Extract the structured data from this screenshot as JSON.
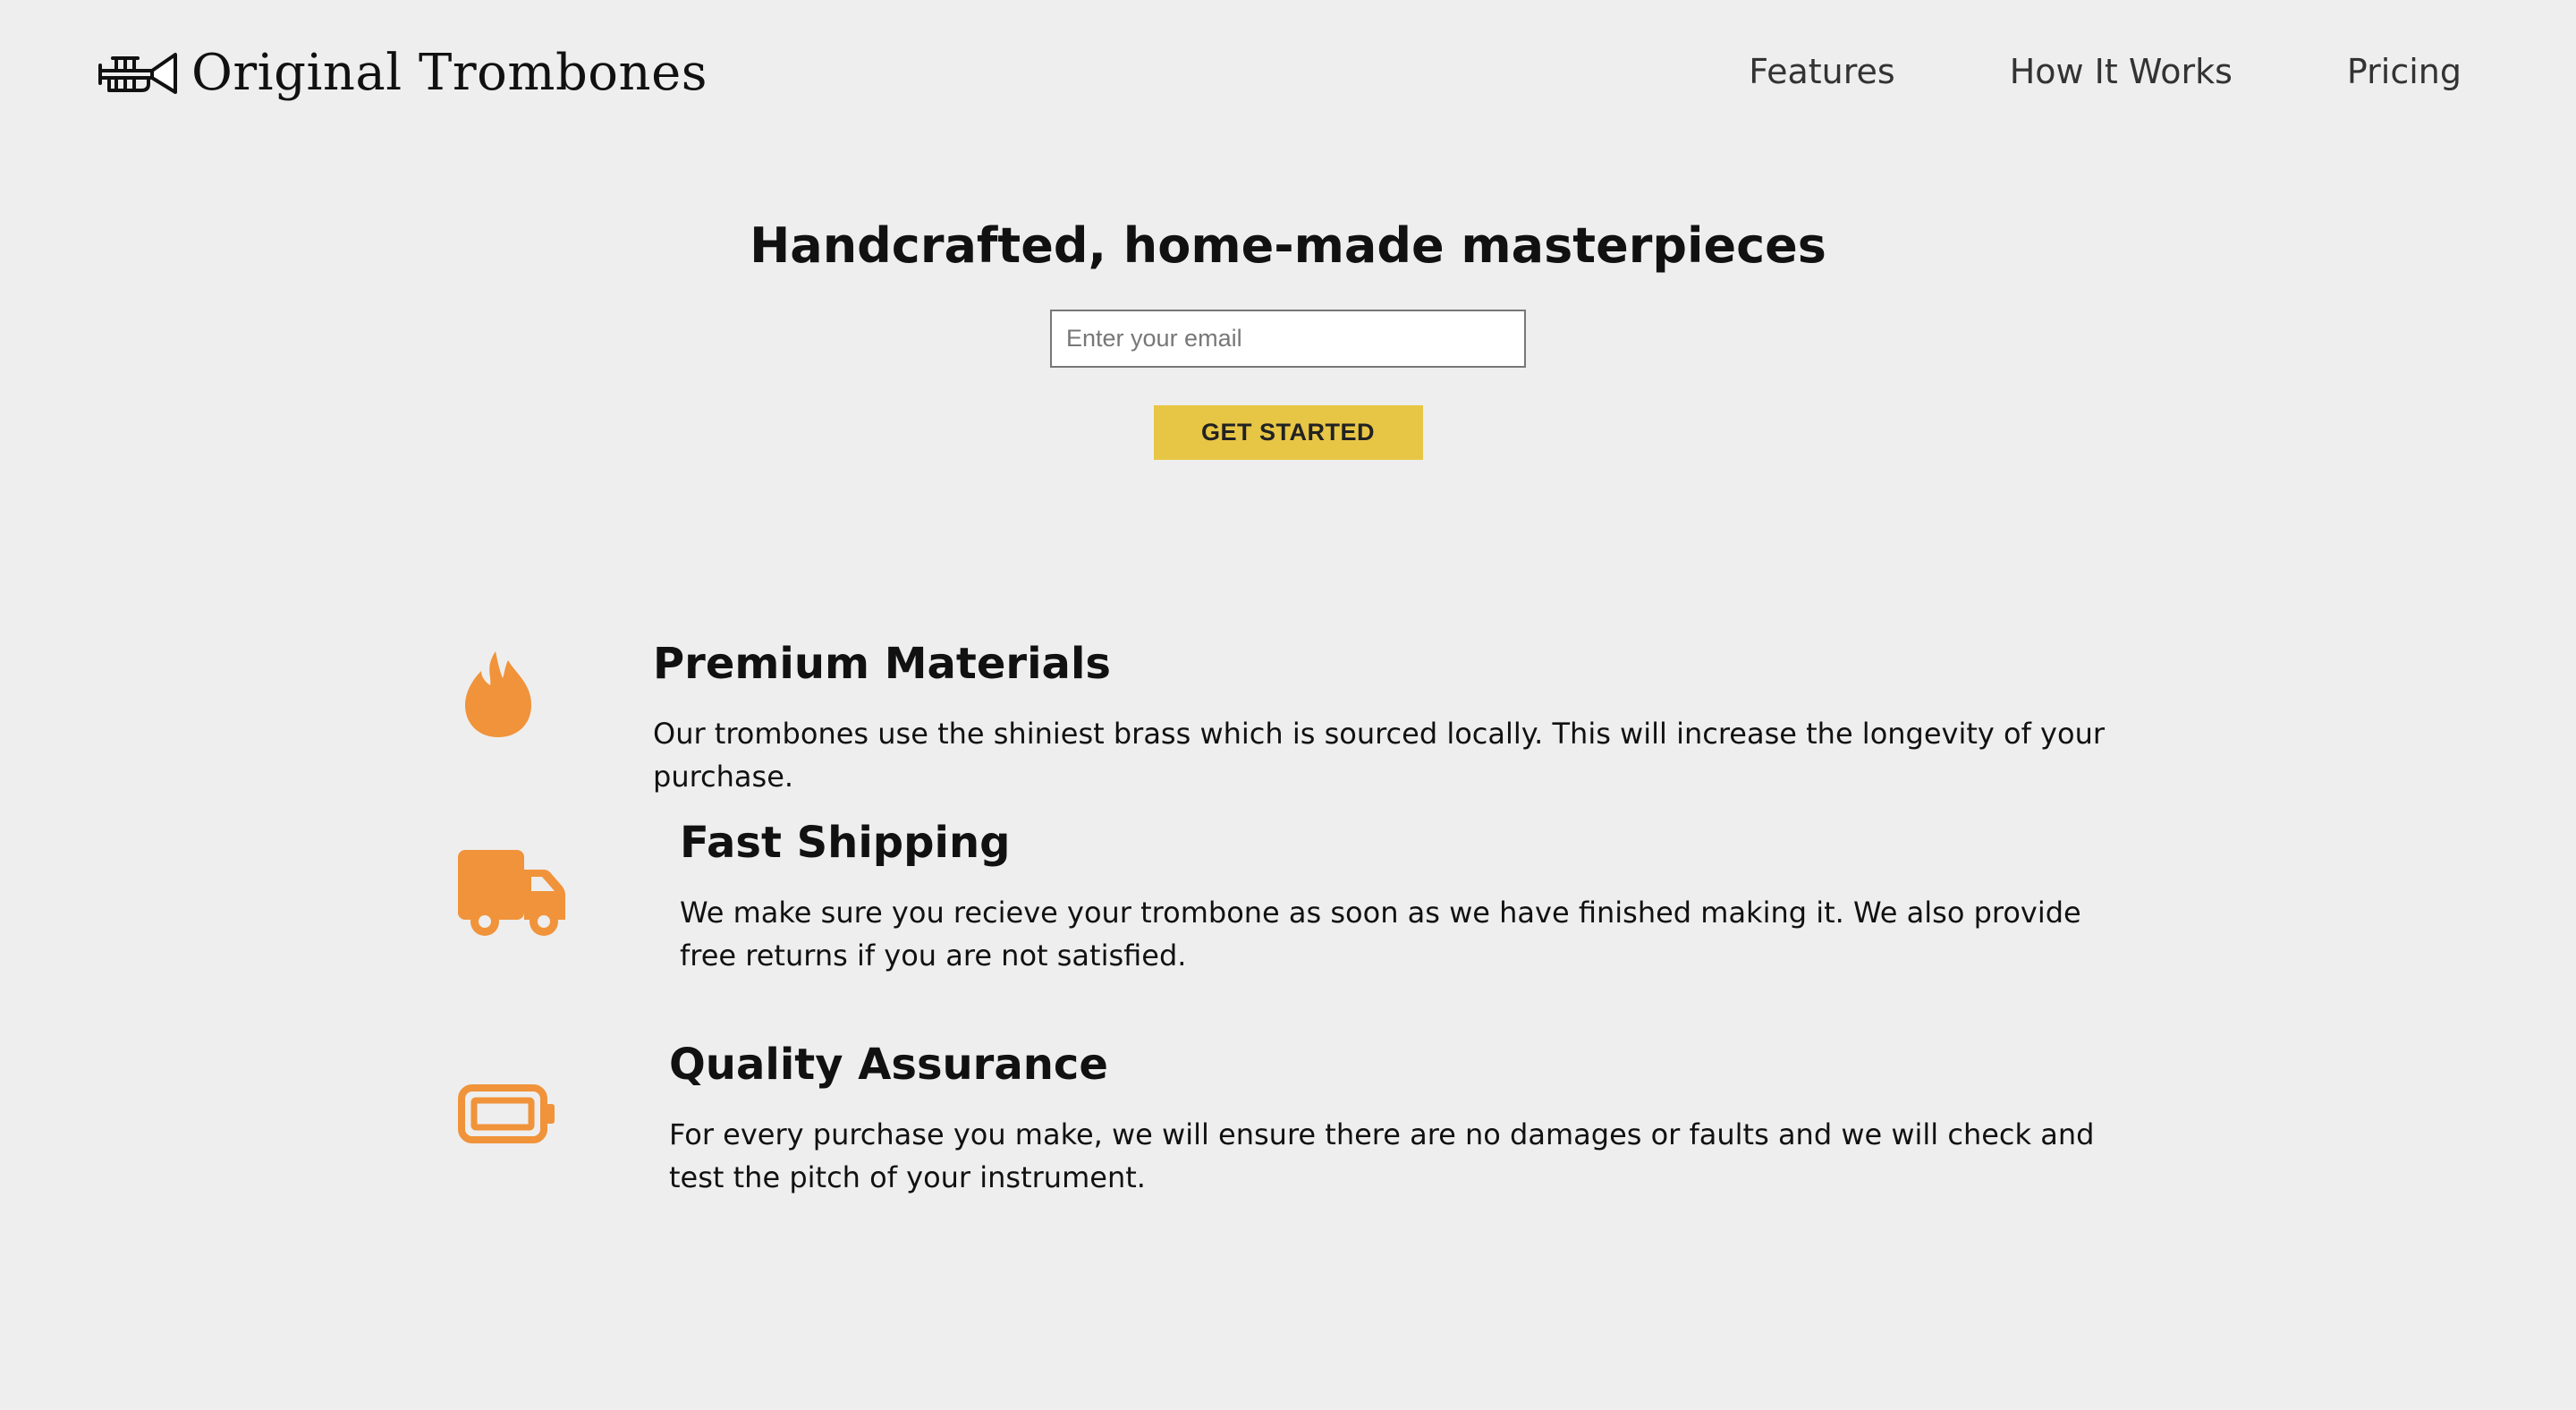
{
  "brand": {
    "name": "Original Trombones",
    "logo_icon": "trombone-icon"
  },
  "nav": {
    "items": [
      {
        "label": "Features"
      },
      {
        "label": "How It Works"
      },
      {
        "label": "Pricing"
      }
    ]
  },
  "hero": {
    "title": "Handcrafted, home-made masterpieces",
    "email_placeholder": "Enter your email",
    "cta_label": "GET STARTED"
  },
  "features": [
    {
      "icon": "flame-icon",
      "title": "Premium Materials",
      "text": "Our trombones use the shiniest brass which is sourced locally. This will increase the longevity of your purchase."
    },
    {
      "icon": "truck-icon",
      "title": "Fast Shipping",
      "text": "We make sure you recieve your trombone as soon as we have finished making it. We also provide free returns if you are not satisfied."
    },
    {
      "icon": "battery-icon",
      "title": "Quality Assurance",
      "text": "For every purchase you make, we will ensure there are no damages or faults and we will check and test the pitch of your instrument."
    }
  ],
  "colors": {
    "background": "#eeeeee",
    "accent_button": "#e8c645",
    "icon_orange": "#f0933a"
  }
}
